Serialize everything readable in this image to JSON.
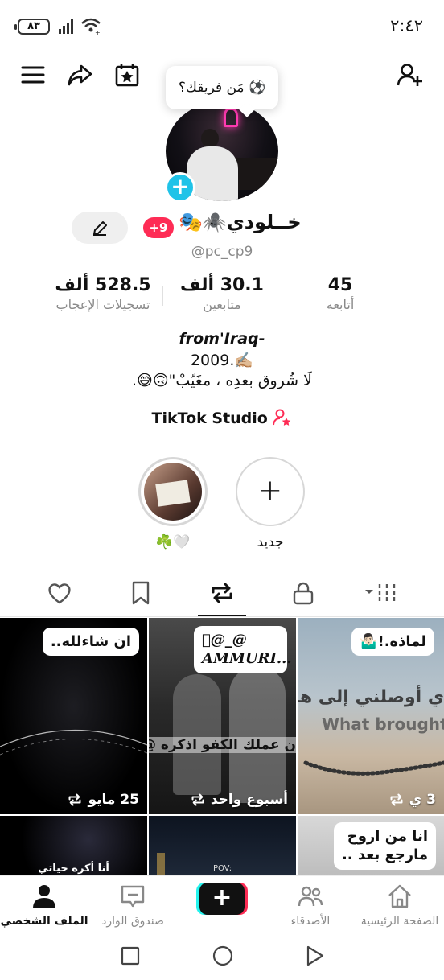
{
  "status": {
    "time": "٢:٤٢",
    "battery": "٨٣"
  },
  "profile": {
    "team_prompt": "مَن فريقك؟",
    "display_name": "خــلودي",
    "name_emojis": "🕷️🎭",
    "notif_count": "+9",
    "username": "@pc_cp9",
    "stats": [
      {
        "key": "likes",
        "value": "528.5 ألف",
        "label": "تسجيلات الإعجاب"
      },
      {
        "key": "followers",
        "value": "30.1 ألف",
        "label": "متابعين"
      },
      {
        "key": "following",
        "value": "45",
        "label": "أتابعه"
      }
    ],
    "bio_line1": "from'Iraq-",
    "bio_line2": "2009.✍🏼",
    "bio_line3": "لَا شُروق بعدِه ، مغَيّبْ\"🙃😅.",
    "studio_label": "TikTok Studio"
  },
  "stories": {
    "highlight_label": "☘️🤍",
    "new_label": "جديد"
  },
  "grid": [
    {
      "caption": "ان شاءلله..",
      "meta": "25 مايو",
      "theme": "dark"
    },
    {
      "caption": "@ٍ_@\nAMMURI...",
      "meta": "أسبوع واحد",
      "theme": "gray"
    },
    {
      "caption": "لماذه.!🤷🏻‍♂️",
      "meta": "3 ي",
      "theme": "sea"
    },
    {
      "caption": "",
      "meta": "",
      "theme": "space"
    },
    {
      "caption": "",
      "meta": "",
      "theme": "night"
    },
    {
      "caption": "انا من اروح\nمارجع بعد ..",
      "meta": "",
      "theme": "light"
    }
  ],
  "tile_overlay_text": {
    "t2": "ن عملك الكفو اذكره @",
    "t3": "ي أوصلني إلى هنا!",
    "t3_en": "What brought me",
    "t4": "أنا أكره حياتي",
    "t5": "POV:"
  },
  "bottom_nav": [
    {
      "key": "home",
      "label": "الصفحة الرئيسية"
    },
    {
      "key": "friends",
      "label": "الأصدقاء"
    },
    {
      "key": "inbox",
      "label": "صندوق الوارد"
    },
    {
      "key": "profile",
      "label": "الملف الشخصي"
    }
  ],
  "colors": {
    "accent_red": "#fe2c55",
    "accent_cyan": "#25f4ee",
    "avatar_plus": "#20c3e8"
  }
}
